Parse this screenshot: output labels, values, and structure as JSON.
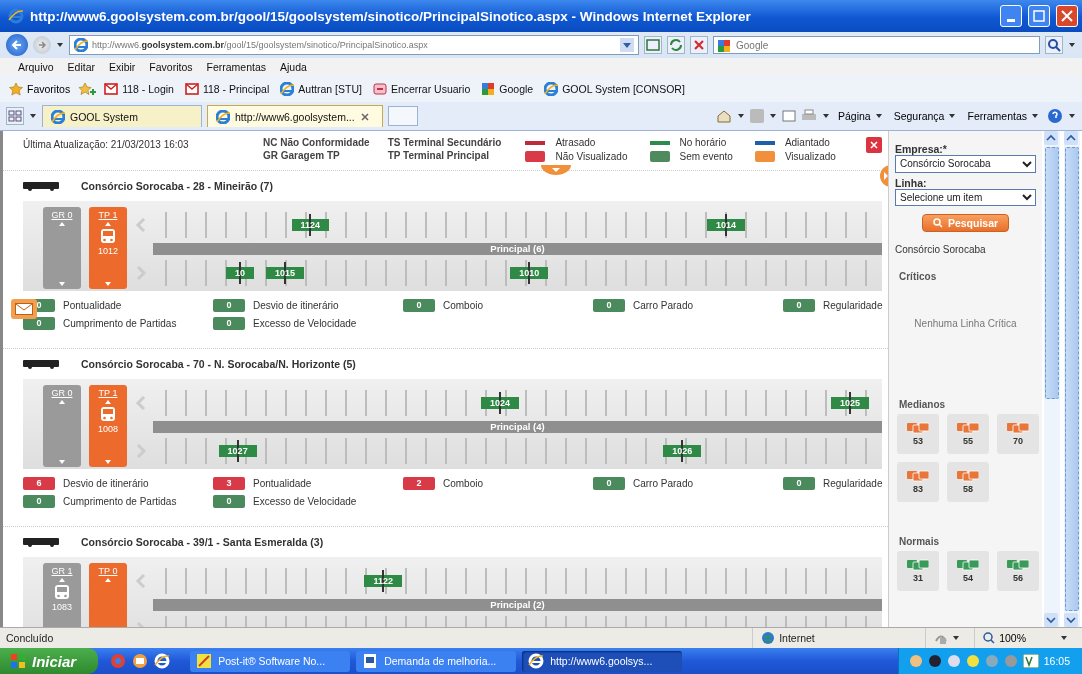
{
  "window": {
    "title": "http://www6.goolsystem.com.br/gool/15/goolsystem/sinotico/PrincipalSinotico.aspx - Windows Internet Explorer"
  },
  "address_bar": {
    "url": "http://www6.**goolsystem.com.br**/gool/15/goolsystem/sinotico/PrincipalSinotico.aspx",
    "search_placeholder": "Google"
  },
  "menu": [
    "Arquivo",
    "Editar",
    "Exibir",
    "Favoritos",
    "Ferramentas",
    "Ajuda"
  ],
  "favorites_bar": {
    "label": "Favoritos",
    "items": [
      {
        "label": "118 - Login",
        "kind": "red"
      },
      {
        "label": "118 - Principal",
        "kind": "red"
      },
      {
        "label": "Auttran [STU]",
        "kind": "ie"
      },
      {
        "label": "Encerrar Usuario",
        "kind": "pink"
      },
      {
        "label": "Google",
        "kind": "google"
      },
      {
        "label": "GOOL System [CONSOR]",
        "kind": "ie"
      }
    ]
  },
  "tabs": [
    {
      "label": "GOOL System",
      "selected": false
    },
    {
      "label": "http://www6.goolsystem...",
      "selected": true
    }
  ],
  "command_bar": [
    "Página",
    "Segurança",
    "Ferramentas"
  ],
  "header": {
    "last_update": "Última Atualização: 21/03/2013 16:03",
    "abbreviations": [
      "NC Não Conformidade",
      "GR Garagem TP",
      "TS Terminal Secundário",
      "TP Terminal Principal"
    ],
    "legend": [
      {
        "label": "Atrasado",
        "kind": "line",
        "color": "#c0283c"
      },
      {
        "label": "Não Visualizado",
        "kind": "square",
        "color": "#d93a48"
      },
      {
        "label": "No horário",
        "kind": "line",
        "color": "#2e8b4e"
      },
      {
        "label": "Sem evento",
        "kind": "square",
        "color": "#4f8a5f"
      },
      {
        "label": "Adiantado",
        "kind": "line",
        "color": "#1f5fa8"
      },
      {
        "label": "Visualizado",
        "kind": "square",
        "color": "#f0903a"
      }
    ]
  },
  "lines": [
    {
      "title": "Consórcio Sorocaba - 28 - Mineirão (7)",
      "garage": {
        "label": "GR 0"
      },
      "terminal": {
        "label": "TP 1",
        "bus": "1012"
      },
      "route": "Principal (6)",
      "buses": [
        {
          "label": "1124",
          "kind": "upper",
          "level": 0.19
        },
        {
          "label": "1014",
          "kind": "upper",
          "level": 0.76
        },
        {
          "label": "10",
          "kind": "lower",
          "level": 0.1
        },
        {
          "label": "1015",
          "kind": "lower",
          "level": 0.155
        },
        {
          "label": "1010",
          "kind": "lower",
          "level": 0.49
        }
      ],
      "indicators": [
        {
          "label": "Pontualidade",
          "count": "0",
          "color": "#4a8a5c"
        },
        {
          "label": "Desvio de itinerário",
          "count": "0",
          "color": "#4a8a5c"
        },
        {
          "label": "Comboio",
          "count": "0",
          "color": "#4a8a5c"
        },
        {
          "label": "Carro Parado",
          "count": "0",
          "color": "#4a8a5c"
        },
        {
          "label": "Regularidade",
          "count": "0",
          "color": "#4a8a5c"
        },
        {
          "label": "Cumprimento de Partidas",
          "count": "0",
          "color": "#4a8a5c"
        },
        {
          "label": "Excesso de Velocidade",
          "count": "0",
          "color": "#4a8a5c"
        }
      ]
    },
    {
      "title": "Consórcio Sorocaba - 70 - N. Sorocaba/N. Horizonte (5)",
      "garage": {
        "label": "GR 0"
      },
      "terminal": {
        "label": "TP 1",
        "bus": "1008"
      },
      "route": "Principal (4)",
      "buses": [
        {
          "label": "1024",
          "kind": "upper",
          "level": 0.45
        },
        {
          "label": "1025",
          "kind": "upper",
          "level": 0.93
        },
        {
          "label": "1027",
          "kind": "lower",
          "level": 0.09
        },
        {
          "label": "1026",
          "kind": "lower",
          "level": 0.7
        }
      ],
      "indicators": [
        {
          "label": "Desvio de itinerário",
          "count": "6",
          "color": "#d93a48"
        },
        {
          "label": "Pontualidade",
          "count": "3",
          "color": "#d93a48"
        },
        {
          "label": "Comboio",
          "count": "2",
          "color": "#d93a48"
        },
        {
          "label": "Carro Parado",
          "count": "0",
          "color": "#4a8a5c"
        },
        {
          "label": "Regularidade",
          "count": "0",
          "color": "#4a8a5c"
        },
        {
          "label": "Cumprimento de Partidas",
          "count": "0",
          "color": "#4a8a5c"
        },
        {
          "label": "Excesso de Velocidade",
          "count": "0",
          "color": "#4a8a5c"
        }
      ]
    },
    {
      "title": "Consórcio Sorocaba - 39/1 - Santa Esmeralda (3)",
      "garage": {
        "label": "GR 1",
        "bus": "1083"
      },
      "terminal": {
        "label": "TP 0"
      },
      "route": "Principal (2)",
      "buses": [
        {
          "label": "1122",
          "kind": "upper",
          "level": 0.29
        }
      ]
    }
  ],
  "sidebar": {
    "company_label": "Empresa:*",
    "company": "Consórcio Sorocaba",
    "line_label": "Linha:",
    "line": "Selecione um item",
    "search_button": "Pesquisar",
    "company_name": "Consórcio Sorocaba",
    "groups": [
      {
        "title": "Críticos",
        "kind": "critical",
        "empty_text": "Nenhuma Linha Crítica"
      },
      {
        "title": "Medianos",
        "kind": "medium",
        "tiles": [
          "53",
          "55",
          "70",
          "83",
          "58"
        ]
      },
      {
        "title": "Normais",
        "kind": "normal",
        "tiles": [
          "31",
          "54",
          "56"
        ]
      }
    ]
  },
  "status_bar": {
    "text": "Concluído",
    "zone": "Internet",
    "zoom": "100%"
  },
  "taskbar": {
    "start": "Iniciar",
    "windows": [
      {
        "label": "Post-it® Software No...",
        "kind": "postit",
        "selected": false
      },
      {
        "label": "Demanda de melhoria...",
        "kind": "doc",
        "selected": false
      },
      {
        "label": "http://www6.goolsys...",
        "kind": "ie",
        "selected": true
      }
    ],
    "clock": "16:05"
  }
}
